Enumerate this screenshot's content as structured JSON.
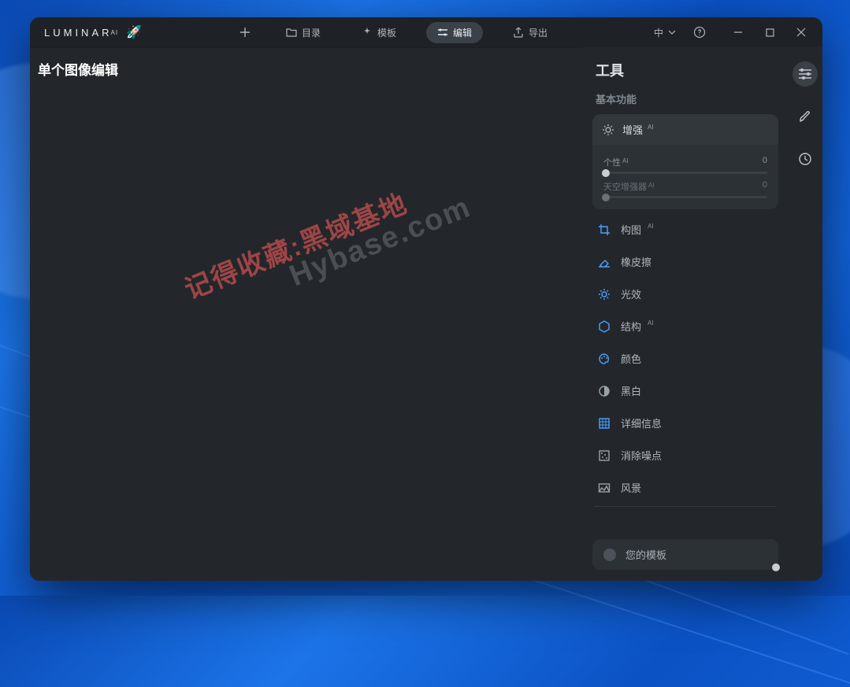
{
  "app": {
    "name": "LUMINAR",
    "suffix": "AI"
  },
  "titlebar": {
    "nav": {
      "catalog": "目录",
      "templates": "模板",
      "edit": "编辑",
      "export": "导出"
    },
    "language": "中"
  },
  "canvas": {
    "title": "单个图像编辑"
  },
  "watermark": {
    "line1": "记得收藏:黑域基地",
    "line2": "Hybase.com"
  },
  "panel": {
    "title": "工具",
    "section_basic": "基本功能",
    "enhance": {
      "label": "增强"
    },
    "sliders": {
      "personality": {
        "label": "个性",
        "value": "0"
      },
      "sky_enhancer": {
        "label": "天空增强器",
        "value": "0"
      }
    },
    "tools": [
      {
        "label": "构图",
        "ai": true,
        "icon": "crop",
        "color": "blue"
      },
      {
        "label": "橡皮擦",
        "ai": false,
        "icon": "eraser",
        "color": "blue"
      },
      {
        "label": "光效",
        "ai": false,
        "icon": "sun",
        "color": "blue"
      },
      {
        "label": "结构",
        "ai": true,
        "icon": "hex",
        "color": "blue"
      },
      {
        "label": "颜色",
        "ai": false,
        "icon": "palette",
        "color": "blue"
      },
      {
        "label": "黑白",
        "ai": false,
        "icon": "bw",
        "color": "grey"
      },
      {
        "label": "详细信息",
        "ai": false,
        "icon": "grid",
        "color": "blue"
      },
      {
        "label": "消除噪点",
        "ai": false,
        "icon": "denoise",
        "color": "grey"
      },
      {
        "label": "风景",
        "ai": false,
        "icon": "landscape",
        "color": "grey"
      }
    ],
    "template_bar": "您的模板"
  }
}
